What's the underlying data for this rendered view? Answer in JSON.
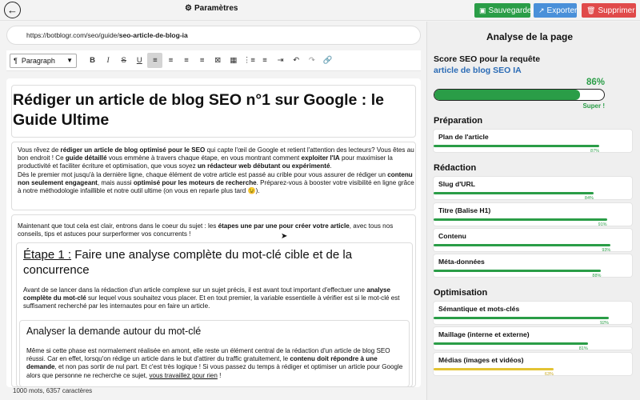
{
  "topbar": {
    "back_icon": "arrow-left-icon",
    "settings_label": "Paramètres",
    "save_label": "Sauvegarder",
    "export_label": "Exporter",
    "delete_label": "Supprimer",
    "colors": {
      "save": "#2a9d47",
      "export": "#4a90d9",
      "delete": "#e04a4a"
    }
  },
  "url": {
    "prefix": "https://botblogr.com/seo/guide/",
    "slug": "seo-article-de-blog-ia"
  },
  "toolbar": {
    "paragraph_label": "Paragraph",
    "buttons": [
      "B",
      "I",
      "S",
      "U",
      "align-left",
      "align-center",
      "align-right",
      "align-justify",
      "clear-format",
      "table",
      "bullet-list",
      "numbered-list",
      "indent",
      "undo",
      "link"
    ]
  },
  "article": {
    "title": "Rédiger un article de blog SEO n°1 sur Google : le Guide Ultime",
    "intro": {
      "t1": "Vous rêvez de ",
      "b1": "rédiger un article de blog optimisé pour le SEO",
      "t2": " qui capte l'œil de Google et retient l'attention des lecteurs? Vous êtes au bon endroit ! Ce ",
      "b2": "guide détaillé",
      "t3": " vous emmène à travers chaque étape, en vous montrant comment ",
      "b3": "exploiter l'IA",
      "t4": " pour maximiser la productivité et faciliter écriture et optimisation, que vous soyez ",
      "b4": "un rédacteur web débutant ou expérimenté",
      "t5": ".",
      "t6": "Dès le premier mot jusqu'à la dernière ligne, chaque élément de votre article est passé au crible pour vous assurer de rédiger un ",
      "b5": "contenu non seulement engageant",
      "t7": ", mais aussi ",
      "b6": "optimisé pour les moteurs de recherche",
      "t8": ". Préparez-vous à booster votre visibilité en ligne grâce à notre méthodologie infaillible et notre outil ultime (on vous en reparle plus tard 😉)."
    },
    "lead": {
      "t1": "Maintenant que tout cela est clair, entrons dans le coeur du sujet : les ",
      "b1": "étapes une par une pour créer votre article",
      "t2": ", avec tous nos conseils, tips et astuces pour surperformer vos concurrents !"
    },
    "step1": {
      "label": "Étape 1 :",
      "heading": " Faire une analyse complète du mot-clé cible et de la concurrence",
      "t1": "Avant de se lancer dans la rédaction d'un article complexe sur un sujet précis, il est avant tout important d'effectuer une ",
      "b1": "analyse complète du mot-clé",
      "t2": " sur lequel vous souhaitez vous placer. Et en tout premier, la variable essentielle à vérifier est si le mot-clé est suffisament recherché par les internautes pour en faire un article."
    },
    "sub1": {
      "heading": "Analyser la demande autour du mot-clé",
      "t1": "Même si cette phase est normalement réalisée en amont, elle reste un élément central de la rédaction d'un article de blog SEO réussi. Car en effet, lorsqu'on rédige un article dans le but d'attirer du traffic gratuitement, le ",
      "b1": "contenu doit répondre à une demande",
      "t2": ", et non pas sortir de nul part. Et c'est très logique ! Si vous passez du temps à rédiger et optimiser un article pour Google alors que personne ne recherche ce sujet, ",
      "u1": "vous travaillez pour rien",
      "t3": " !"
    }
  },
  "status": "1000 mots, 6357 caractères",
  "panel": {
    "title": "Analyse de la page",
    "score_label": "Score SEO pour la requête",
    "query": "article de blog SEO IA",
    "score_pct": "86%",
    "score_value": 0.86,
    "score_msg": "Super !",
    "sections": [
      {
        "title": "Préparation",
        "items": [
          {
            "label": "Plan de l'article",
            "pct": "87%",
            "value": 0.87,
            "color": "#2a9d47"
          }
        ]
      },
      {
        "title": "Rédaction",
        "items": [
          {
            "label": "Slug d'URL",
            "pct": "84%",
            "value": 0.84,
            "color": "#2a9d47"
          },
          {
            "label": "Titre (Balise H1)",
            "pct": "91%",
            "value": 0.91,
            "color": "#2a9d47"
          },
          {
            "label": "Contenu",
            "pct": "93%",
            "value": 0.93,
            "color": "#2a9d47"
          },
          {
            "label": "Méta-données",
            "pct": "88%",
            "value": 0.88,
            "color": "#2a9d47"
          }
        ]
      },
      {
        "title": "Optimisation",
        "items": [
          {
            "label": "Sémantique et mots-clés",
            "pct": "92%",
            "value": 0.92,
            "color": "#2a9d47"
          },
          {
            "label": "Maillage (interne et externe)",
            "pct": "81%",
            "value": 0.81,
            "color": "#2a9d47"
          },
          {
            "label": "Médias (images et vidéos)",
            "pct": "63%",
            "value": 0.63,
            "color": "#e3c334"
          }
        ]
      }
    ]
  }
}
